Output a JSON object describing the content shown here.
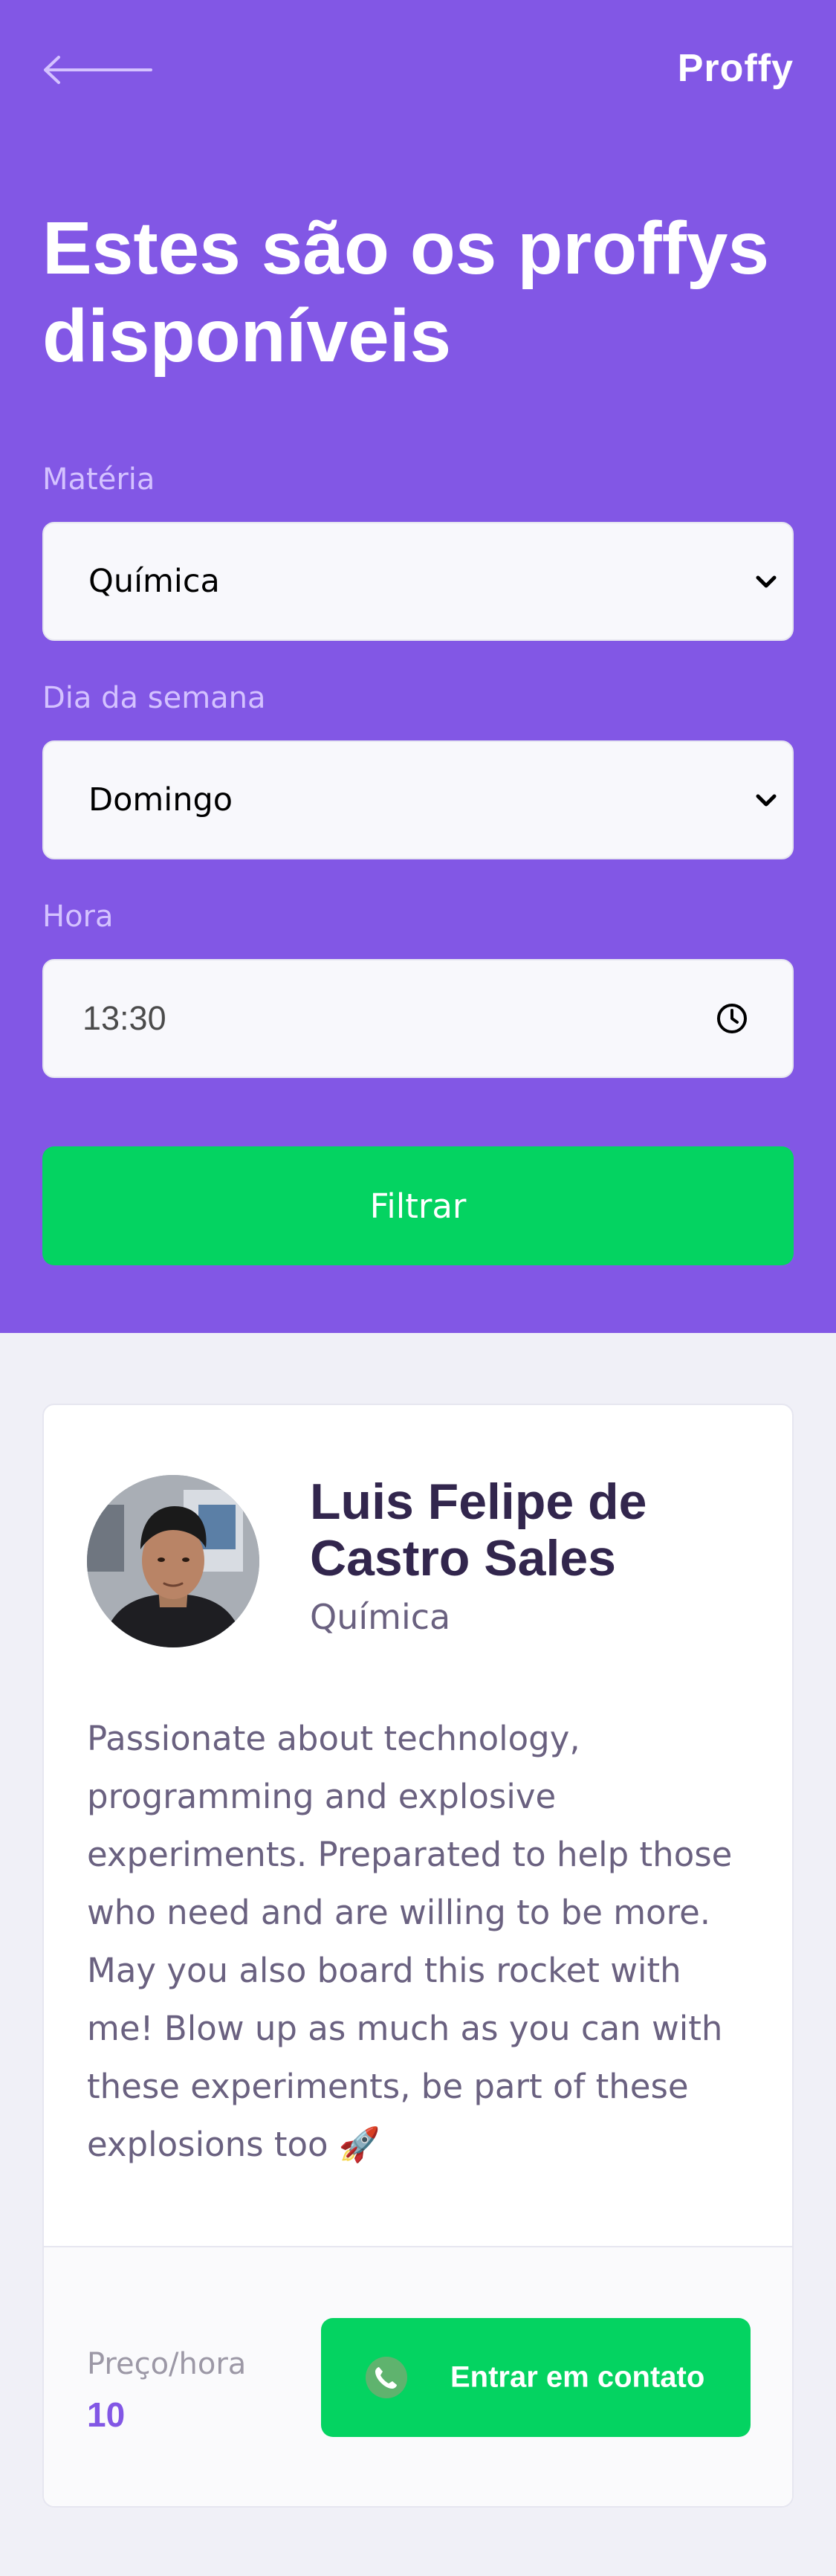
{
  "header": {
    "logo": "Proffy",
    "title": "Estes são os proffys disponíveis"
  },
  "filters": {
    "subject": {
      "label": "Matéria",
      "value": "Química"
    },
    "weekday": {
      "label": "Dia da semana",
      "value": "Domingo"
    },
    "time": {
      "label": "Hora",
      "value": "13:30"
    },
    "submit_label": "Filtrar"
  },
  "teacher": {
    "name": "Luis Felipe de Castro Sales",
    "subject": "Química",
    "bio": "Passionate about technology, programming and explosive experiments. Preparated to help those who need and are willing to be more. May you also board this rocket with me! Blow up as much as you can with these experiments, be part of these explosions too",
    "bio_emoji": "🚀",
    "price_label": "Preço/hora",
    "price": "10",
    "contact_label": "Entrar em contato"
  },
  "colors": {
    "primary": "#8257E5",
    "secondary": "#04D361",
    "background": "#F0F0F7",
    "title_in_primary": "#FFFFFF",
    "text_title": "#32264D",
    "text_base": "#6A6180"
  },
  "icons": {
    "back": "arrow-left-icon",
    "select": "chevron-down-icon",
    "time": "clock-icon",
    "contact": "whatsapp-icon"
  }
}
